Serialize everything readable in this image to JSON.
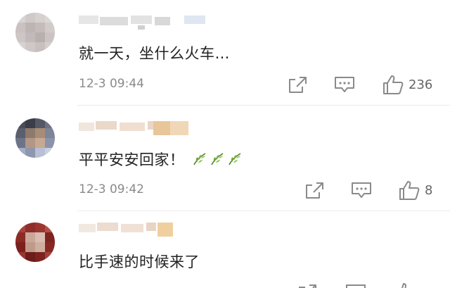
{
  "comments": [
    {
      "text": "就一天，坐什么火车…",
      "time": "12-3 09:44",
      "likes": "236",
      "icons": [
        "forward-icon",
        "comment-icon",
        "thumbs-up-icon"
      ]
    },
    {
      "text": "平平安安回家！",
      "emoji": "leaf-emoji",
      "time": "12-3 09:42",
      "likes": "8",
      "icons": [
        "forward-icon",
        "comment-icon",
        "thumbs-up-icon"
      ]
    },
    {
      "text": "比手速的时候来了",
      "icons": [
        "forward-icon",
        "comment-icon",
        "thumbs-up-icon"
      ]
    }
  ],
  "colors": {
    "meta_text": "#8a8a8a",
    "divider": "#ececec"
  }
}
